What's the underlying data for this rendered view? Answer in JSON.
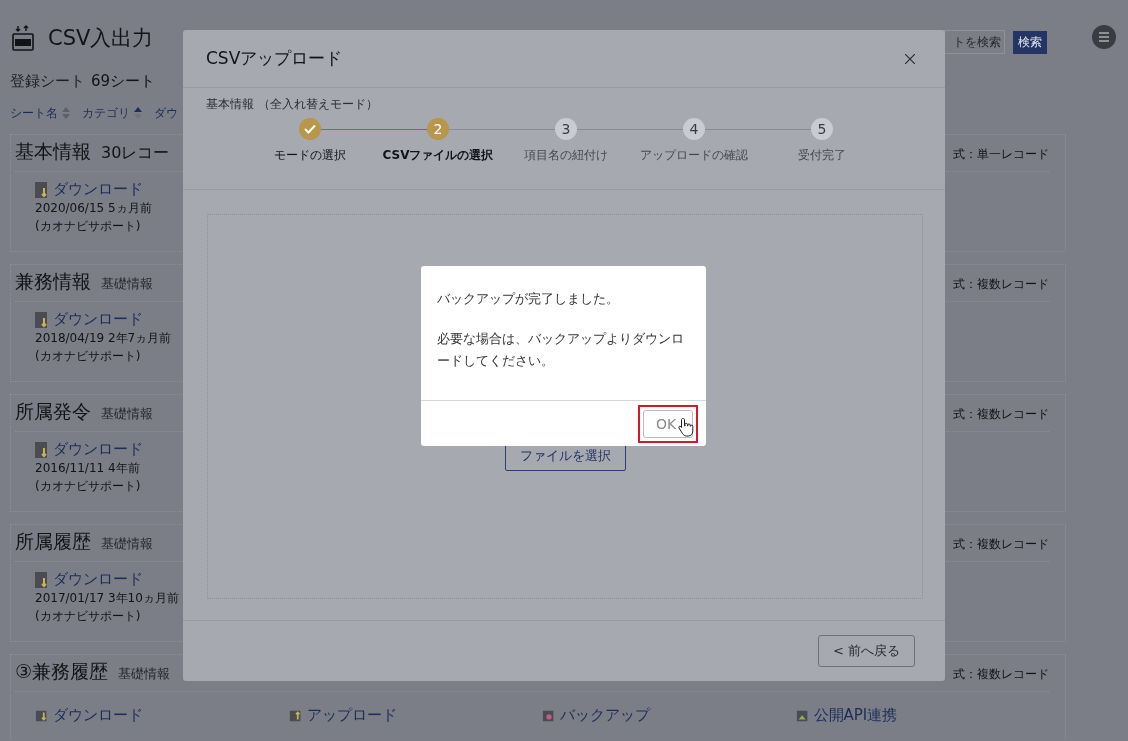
{
  "app": {
    "title": "CSV入出力",
    "registered_label": "登録シート",
    "registered_count": "69シート",
    "search": {
      "placeholder": "トを検索",
      "button": "検索"
    }
  },
  "sort_columns": [
    {
      "label": "シート名",
      "sorted": false
    },
    {
      "label": "カテゴリ",
      "sorted": true
    },
    {
      "label": "ダウ"
    }
  ],
  "sheets": [
    {
      "title": "基本情報",
      "count": "30レコー",
      "format": "式：単一レコード",
      "download": "ダウンロード",
      "date": "2020/06/15 5ヵ月前",
      "author": "(カオナビサポート)"
    },
    {
      "title": "兼務情報",
      "category": "基礎情報",
      "format": "式：複数レコード",
      "download": "ダウンロード",
      "date": "2018/04/19 2年7ヵ月前",
      "author": "(カオナビサポート)"
    },
    {
      "title": "所属発令",
      "category": "基礎情報",
      "format": "式：複数レコード",
      "download": "ダウンロード",
      "date": "2016/11/11 4年前",
      "author": "(カオナビサポート)"
    },
    {
      "title": "所属履歴",
      "category": "基礎情報",
      "format": "式：複数レコード",
      "download": "ダウンロード",
      "date": "2017/01/17 3年10ヵ月前",
      "author": "(カオナビサポート)"
    },
    {
      "title": "③兼務履歴",
      "category": "基礎情報",
      "format": "式：複数レコード",
      "actions": [
        {
          "kind": "download",
          "label": "ダウンロード"
        },
        {
          "kind": "upload",
          "label": "アップロード"
        },
        {
          "kind": "backup",
          "label": "バックアップ"
        },
        {
          "kind": "api",
          "label": "公開API連携"
        }
      ]
    }
  ],
  "modal": {
    "title": "CSVアップロード",
    "subtitle": "基本情報 （全入れ替えモード）",
    "steps": [
      {
        "completed": true,
        "selected": false,
        "label": "モードの選択"
      },
      {
        "completed": false,
        "selected": true,
        "number": "2",
        "label": "CSVファイルの選択"
      },
      {
        "completed": false,
        "selected": false,
        "number": "3",
        "label": "項目名の紐付け"
      },
      {
        "completed": false,
        "selected": false,
        "number": "4",
        "label": "アップロードの確認"
      },
      {
        "completed": false,
        "selected": false,
        "number": "5",
        "label": "受付完了"
      }
    ],
    "file_button": "ファイルを選択",
    "back_button": "< 前へ戻る"
  },
  "alert": {
    "lines": [
      "バックアップが完了しました。",
      "必要な場合は、バックアップよりダウンロードしてください。"
    ],
    "ok": {
      "label": "OK",
      "highlighted": true
    }
  }
}
